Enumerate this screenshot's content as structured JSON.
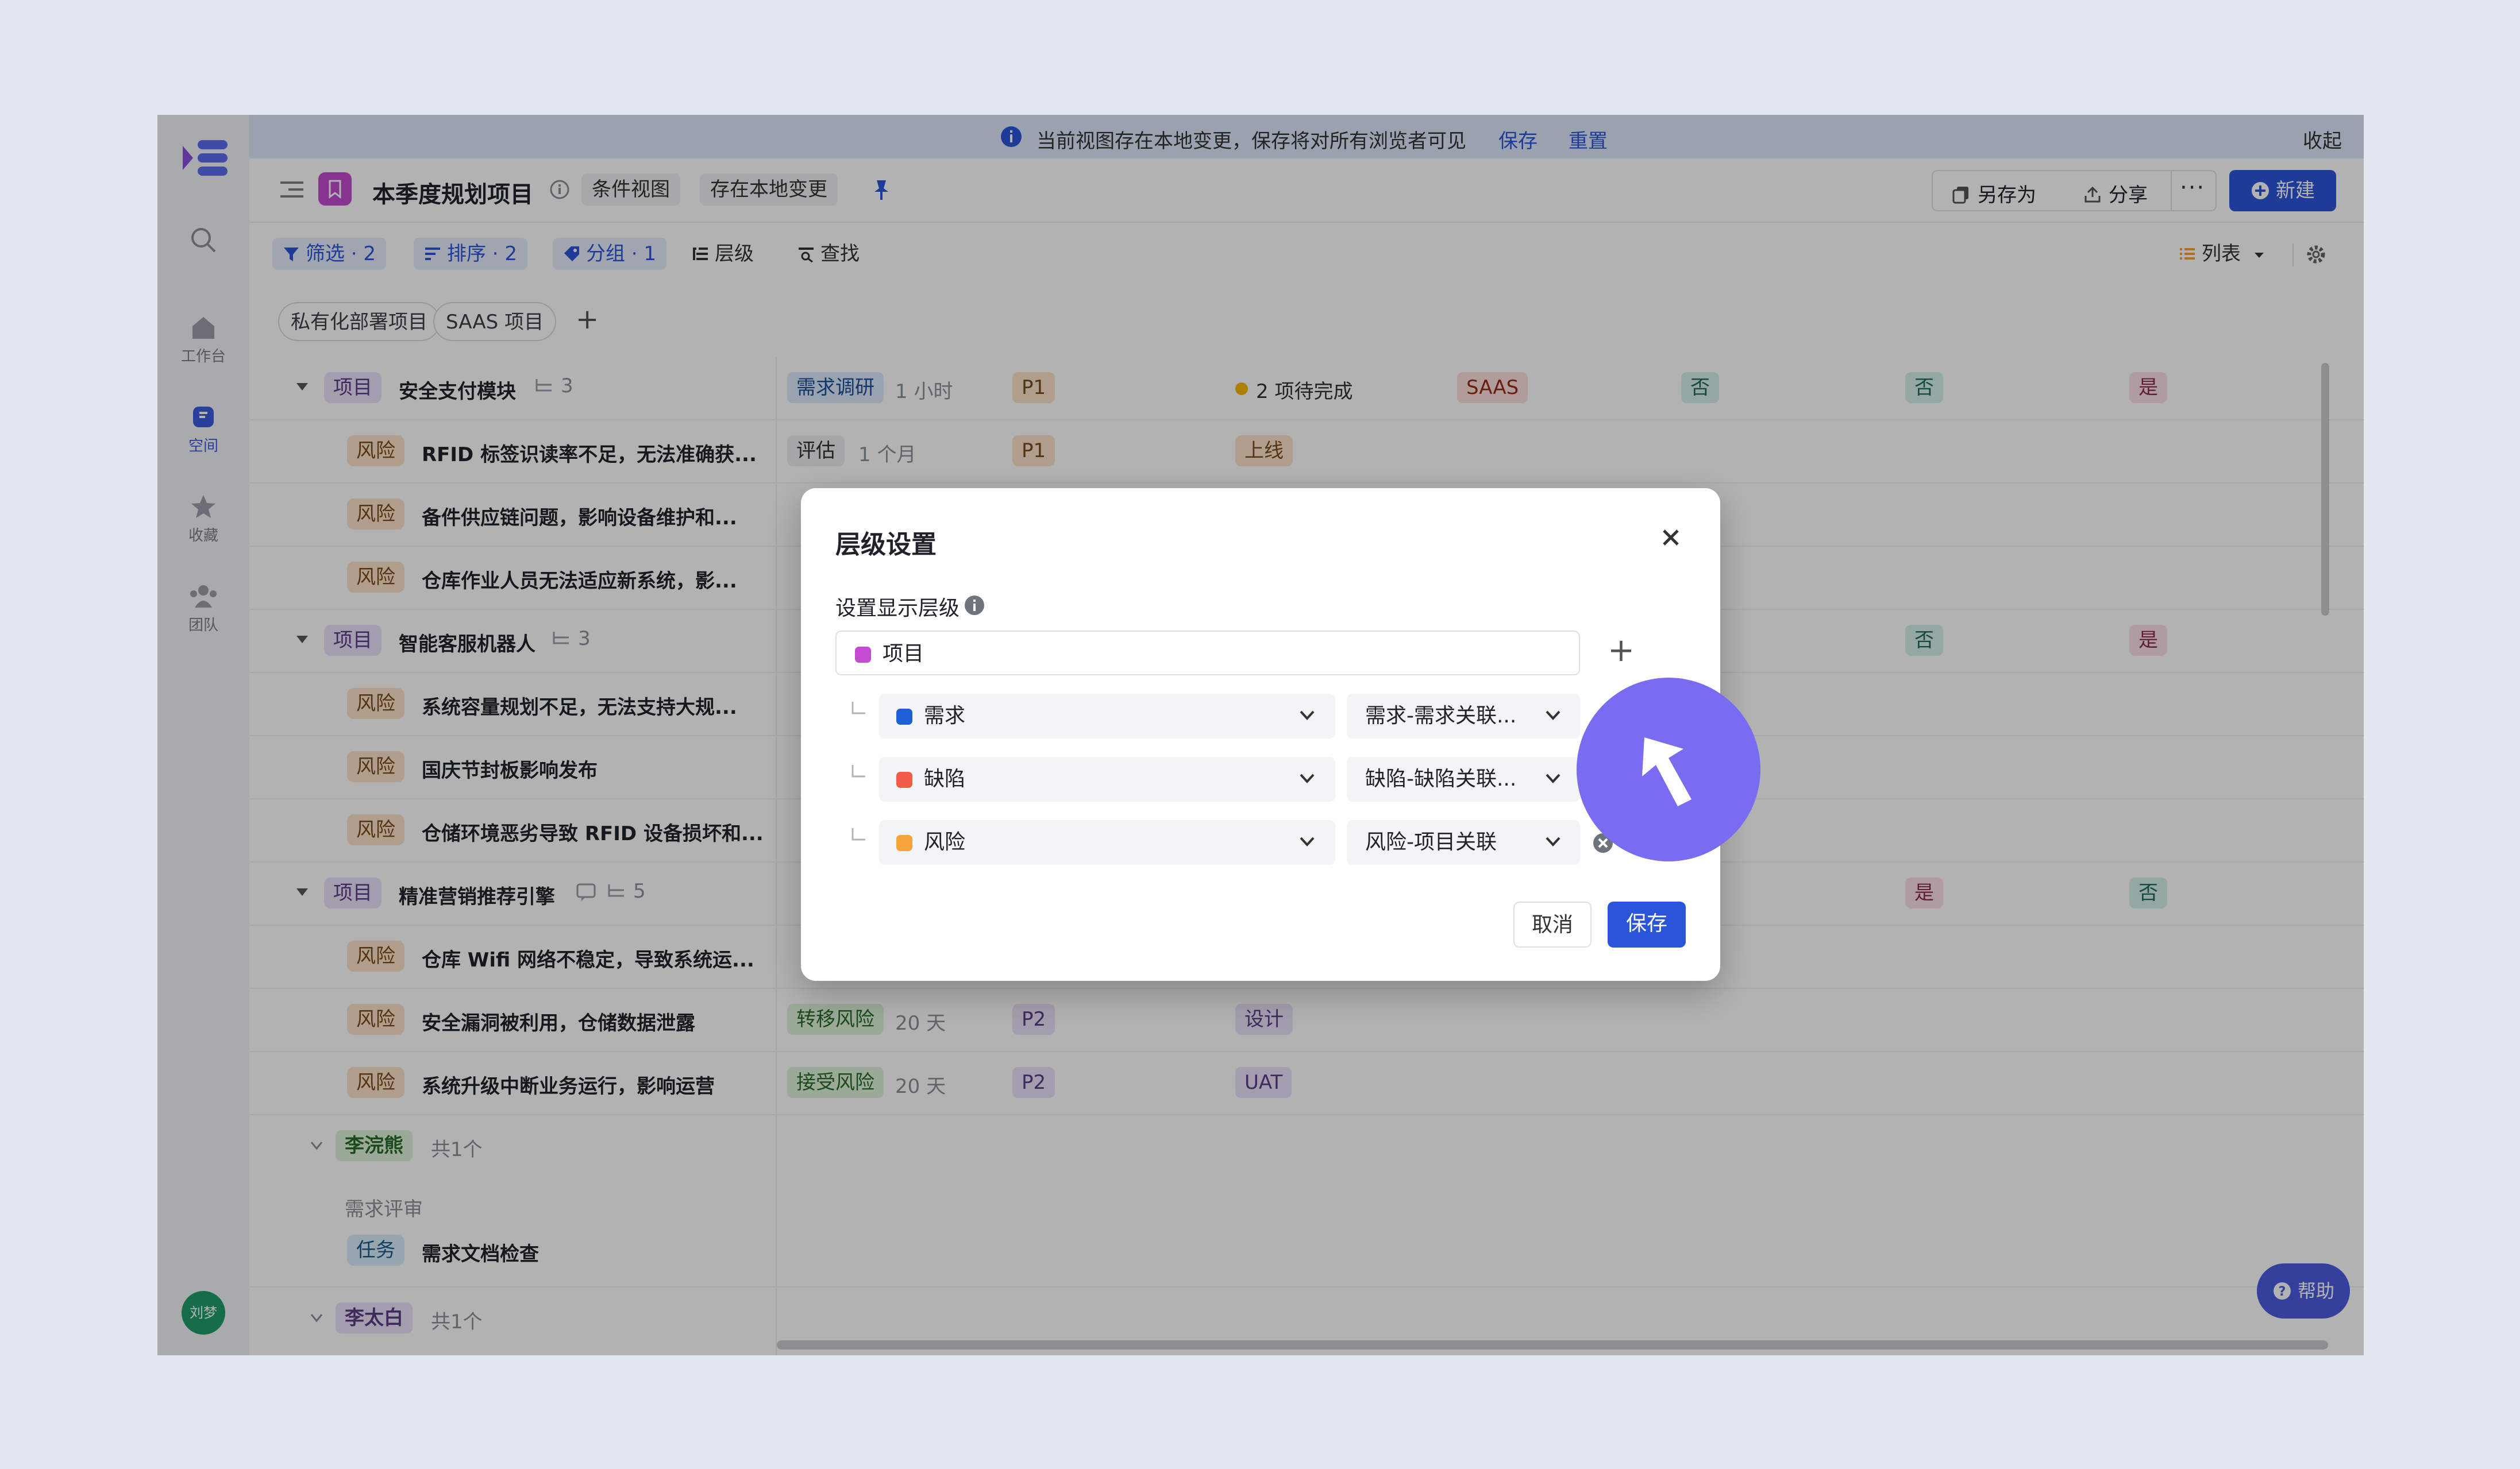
{
  "sidebar": {
    "items": [
      {
        "label": "工作台",
        "icon": "home-icon"
      },
      {
        "label": "空间",
        "icon": "space-icon"
      },
      {
        "label": "收藏",
        "icon": "star-icon"
      },
      {
        "label": "团队",
        "icon": "team-icon"
      }
    ],
    "avatar": "刘梦"
  },
  "banner": {
    "text": "当前视图存在本地变更，保存将对所有浏览者可见",
    "save": "保存",
    "reset": "重置",
    "collapse": "收起"
  },
  "header": {
    "title": "本季度规划项目",
    "tag_condition": "条件视图",
    "tag_local": "存在本地变更",
    "save_as": "另存为",
    "share": "分享",
    "new": "新建"
  },
  "filters": {
    "filter": "筛选 · 2",
    "sort": "排序 · 2",
    "group": "分组 · 1",
    "level": "层级",
    "find": "查找",
    "view": "列表"
  },
  "tag_pills": [
    "私有化部署项目",
    "SAAS 项目"
  ],
  "rows": [
    {
      "type": "项目",
      "title": "安全支付模块",
      "count": "3",
      "c1": "需求调研",
      "c1b": "1 小时",
      "c2": "P1",
      "c3": "2 项待完成",
      "c4": "SAAS",
      "c5": "否",
      "c6": "否",
      "c7": "是"
    },
    {
      "type": "风险",
      "title": "RFID 标签识读率不足，无法准确获...",
      "c1": "评估",
      "c1b": "1 个月",
      "c2": "P1",
      "c3": "上线"
    },
    {
      "type": "风险",
      "title": "备件供应链问题，影响设备维护和..."
    },
    {
      "type": "风险",
      "title": "仓库作业人员无法适应新系统，影..."
    },
    {
      "type": "项目",
      "title": "智能客服机器人",
      "count": "3",
      "c6": "否",
      "c7": "是"
    },
    {
      "type": "风险",
      "title": "系统容量规划不足，无法支持大规..."
    },
    {
      "type": "风险",
      "title": "国庆节封板影响发布"
    },
    {
      "type": "风险",
      "title": "仓储环境恶劣导致 RFID 设备损坏和..."
    },
    {
      "type": "项目",
      "title": "精准营销推荐引擎",
      "count": "5",
      "c6": "是",
      "c7": "否"
    },
    {
      "type": "风险",
      "title": "仓库 Wifi 网络不稳定，导致系统运..."
    },
    {
      "type": "风险",
      "title": "安全漏洞被利用，仓储数据泄露",
      "c1": "转移风险",
      "c1b": "20 天",
      "c2": "P2",
      "c3": "设计"
    },
    {
      "type": "风险",
      "title": "系统升级中断业务运行，影响运营",
      "c1": "接受风险",
      "c1b": "20 天",
      "c2": "P2",
      "c3": "UAT"
    }
  ],
  "groups": [
    {
      "name": "李浣熊",
      "count": "共1个",
      "sub": "需求评审",
      "task_type": "任务",
      "task": "需求文档检查"
    },
    {
      "name": "李太白",
      "count": "共1个"
    }
  ],
  "modal": {
    "title": "层级设置",
    "label": "设置显示层级",
    "top_level": "项目",
    "levels": [
      {
        "name": "需求",
        "relation": "需求-需求关联...",
        "color": "#1f5fd6"
      },
      {
        "name": "缺陷",
        "relation": "缺陷-缺陷关联...",
        "color": "#f25a4a"
      },
      {
        "name": "风险",
        "relation": "风险-项目关联",
        "color": "#f5a33a"
      }
    ],
    "top_color": "#c24bd0",
    "cancel": "取消",
    "save": "保存"
  },
  "help": "帮助"
}
